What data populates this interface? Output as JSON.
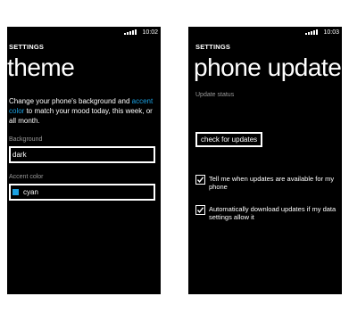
{
  "left_phone": {
    "status": {
      "time": "10:02",
      "signal_icon": "signal-icon"
    },
    "header": "SETTINGS",
    "title": "theme",
    "description_before": "Change your phone's background and ",
    "description_link": "accent color",
    "description_after": " to match your mood today, this week, or all month.",
    "background_label": "Background",
    "background_value": "dark",
    "accent_label": "Accent color",
    "accent_value": "cyan",
    "accent_swatch_color": "#1ba1e2"
  },
  "right_phone": {
    "status": {
      "time": "10:03",
      "signal_icon": "signal-icon"
    },
    "header": "SETTINGS",
    "title": "phone update",
    "update_status_label": "Update status",
    "check_button": "check for updates",
    "options": [
      {
        "label": "Tell me when updates are available for my phone",
        "checked": true
      },
      {
        "label": "Automatically download updates if my data settings allow it",
        "checked": true
      }
    ]
  },
  "colors": {
    "accent": "#1ba1e2",
    "background": "#000000",
    "secondary_text": "#9a9a9a"
  }
}
